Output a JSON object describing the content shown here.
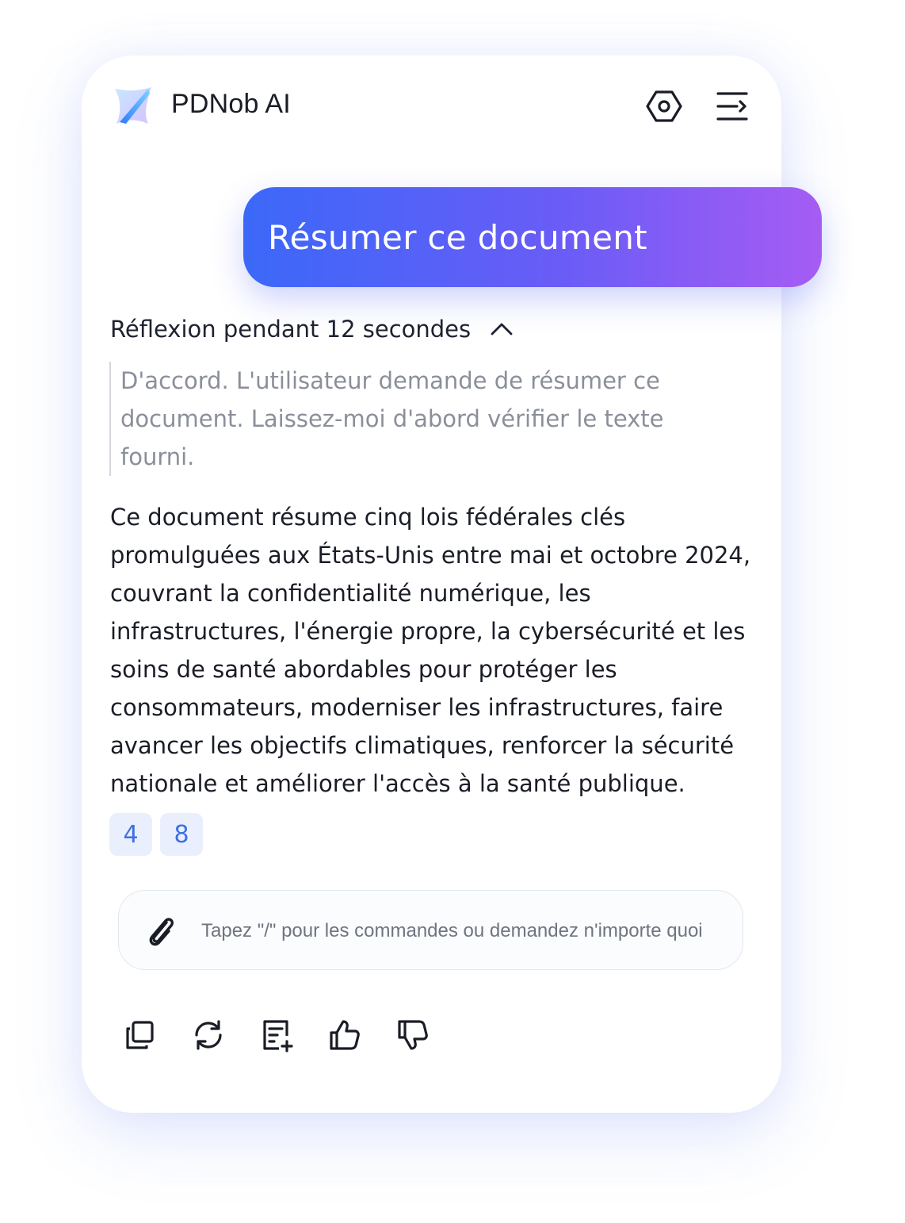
{
  "header": {
    "app_name": "PDNob AI",
    "icons": {
      "logo": "pdnob-logo",
      "settings": "hexagon-settings-icon",
      "panel": "collapse-panel-icon"
    }
  },
  "prompt": {
    "text": "Résumer ce document"
  },
  "reasoning": {
    "label": "Réflexion pendant 12 secondes",
    "thought": "D'accord. L'utilisateur demande de résumer ce document. Laissez-moi d'abord vérifier le texte fourni."
  },
  "answer": {
    "text": "Ce document résume cinq lois fédérales clés promulguées aux États-Unis entre mai et octobre 2024, couvrant la confidentialité numérique, les infrastructures, l'énergie propre, la cybersécurité et les soins de santé abordables pour protéger les consommateurs, moderniser les infrastructures, faire avancer les objectifs climatiques, renforcer la sécurité nationale et améliorer l'accès à la santé publique.",
    "citations": [
      "4",
      "8"
    ]
  },
  "input": {
    "placeholder": "Tapez \"/\" pour les commandes ou demandez n'importe quoi",
    "value": ""
  },
  "actions": [
    "copy-icon",
    "regenerate-icon",
    "add-note-icon",
    "thumbs-up-icon",
    "thumbs-down-icon"
  ],
  "colors": {
    "accent_start": "#3b68f8",
    "accent_end": "#a65cf3",
    "citation_bg": "#e9effd",
    "citation_text": "#3f6fe6"
  }
}
